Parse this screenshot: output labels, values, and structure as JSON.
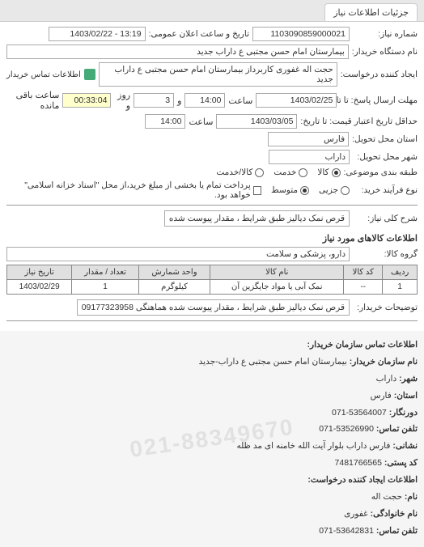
{
  "tab": {
    "title": "جزئیات اطلاعات نیاز"
  },
  "header": {
    "need_no_label": "شماره نیاز:",
    "need_no": "1103090859000021",
    "public_datetime_label": "تاریخ و ساعت اعلان عمومی:",
    "public_datetime": "13:19 - 1403/02/22",
    "buyer_device_label": "نام دستگاه خریدار:",
    "buyer_device": "بیمارستان امام حسن مجتبی  ع  داراب جدید",
    "requester_label": "ایجاد کننده درخواست:",
    "requester": "حجت اله غفوری کاربرداز بیمارستان امام حسن مجتبی  ع  داراب جدید",
    "buyer_contact_label": "اطلاعات تماس خریدار",
    "deadline_label": "مهلت ارسال پاسخ: تا تاریخ:",
    "deadline_date": "1403/02/25",
    "time_label": "ساعت",
    "deadline_time": "14:00",
    "and_label": "و",
    "days_remaining": "3",
    "day_and_label": "روز و",
    "time_remaining": "00:33:04",
    "time_remaining_label": "ساعت باقی مانده",
    "validity_label": "حداقل تاریخ اعتبار قیمت: تا تاریخ:",
    "validity_date": "1403/03/05",
    "validity_time": "14:00",
    "delivery_province_label": "استان محل تحویل:",
    "delivery_province": "فارس",
    "delivery_city_label": "شهر محل تحویل:",
    "delivery_city": "داراب",
    "category_label": "طبقه بندی موضوعی:",
    "cat_goods": "کالا",
    "cat_service": "خدمت",
    "cat_goods_service": "کالا/خدمت",
    "process_label": "نوع فرآیند خرید:",
    "proc_small": "جزیی",
    "proc_medium": "متوسط",
    "proc_note": "پرداخت تمام یا بخشی از مبلغ خرید،از محل \"اسناد خزانه اسلامی\" خواهد بود."
  },
  "need": {
    "overall_label": "شرح کلی نیاز:",
    "overall_desc": "قرص نمک دیالیز طبق شرایط ، مقدار پیوست شده",
    "goods_section": "اطلاعات کالاهای مورد نیاز",
    "group_label": "گروه کالا:",
    "group_value": "دارو، پزشکی و سلامت"
  },
  "table": {
    "headers": [
      "ردیف",
      "کد کالا",
      "نام کالا",
      "واحد شمارش",
      "تعداد / مقدار",
      "تاریخ نیاز"
    ],
    "rows": [
      {
        "idx": "1",
        "code": "--",
        "name": "نمک آبی یا مواد جایگزین آن",
        "unit": "کیلوگرم",
        "qty": "1",
        "date": "1403/02/29"
      }
    ]
  },
  "buyer_notes": {
    "label": "توضیحات خریدار:",
    "value": "قرص نمک دیالیز طبق شرایط ، مقدار پیوست شده هماهنگی 09177323958"
  },
  "contact": {
    "section": "اطلاعات تماس سازمان خریدار:",
    "org_name_label": "نام سازمان خریدار:",
    "org_name": "بیمارستان امام حسن مجتبی ع داراب-جدید",
    "city_label": "شهر:",
    "city": "داراب",
    "province_label": "استان:",
    "province": "فارس",
    "fax_label": "دورنگار:",
    "fax": "53564007-071",
    "phone_label": "تلفن تماس:",
    "phone": "53526990-071",
    "address_label": "نشانی:",
    "address": "فارس داراب بلوار آیت الله خامنه ای مد ظله",
    "postal_label": "کد پستی:",
    "postal": "7481766565",
    "creator_section": "اطلاعات ایجاد کننده درخواست:",
    "fname_label": "نام:",
    "fname": "حجت اله",
    "lname_label": "نام خانوادگی:",
    "lname": "غفوری",
    "cphone_label": "تلفن تماس:",
    "cphone": "53642831-071"
  },
  "watermark": "021-88349670"
}
